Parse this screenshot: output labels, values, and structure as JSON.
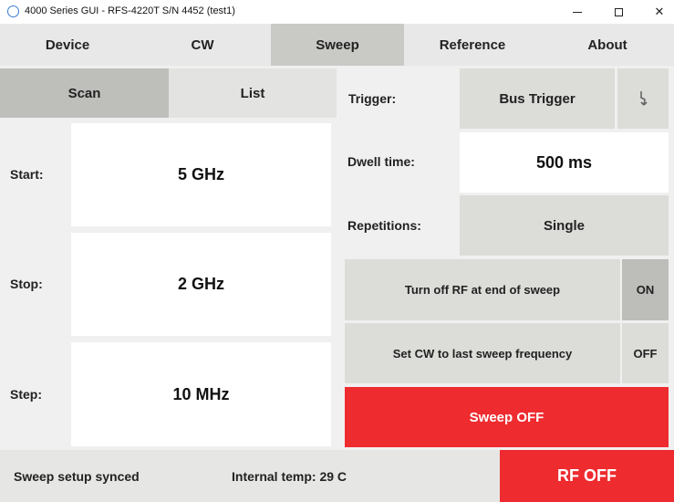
{
  "window": {
    "title": "4000 Series GUI - RFS-4220T S/N 4452 (test1)"
  },
  "tabs": [
    {
      "label": "Device"
    },
    {
      "label": "CW"
    },
    {
      "label": "Sweep"
    },
    {
      "label": "Reference"
    },
    {
      "label": "About"
    }
  ],
  "subtabs": {
    "scan": "Scan",
    "list": "List"
  },
  "scan": {
    "start_label": "Start:",
    "start_value": "5 GHz",
    "stop_label": "Stop:",
    "stop_value": "2 GHz",
    "step_label": "Step:",
    "step_value": "10 MHz"
  },
  "settings": {
    "trigger_label": "Trigger:",
    "trigger_value": "Bus Trigger",
    "trigger_icon": "bolt-icon",
    "dwell_label": "Dwell time:",
    "dwell_value": "500 ms",
    "repetitions_label": "Repetitions:",
    "repetitions_value": "Single",
    "rf_off_end_label": "Turn off RF at end of sweep",
    "rf_off_end_state": "ON",
    "set_cw_label": "Set CW to last sweep frequency",
    "set_cw_state": "OFF",
    "sweep_button": "Sweep OFF"
  },
  "status": {
    "sync": "Sweep setup synced",
    "temp": "Internal temp: 29 C",
    "rf_button": "RF OFF"
  },
  "colors": {
    "red": "#ee2b2f",
    "accent_icon": "#3c7bd4"
  }
}
